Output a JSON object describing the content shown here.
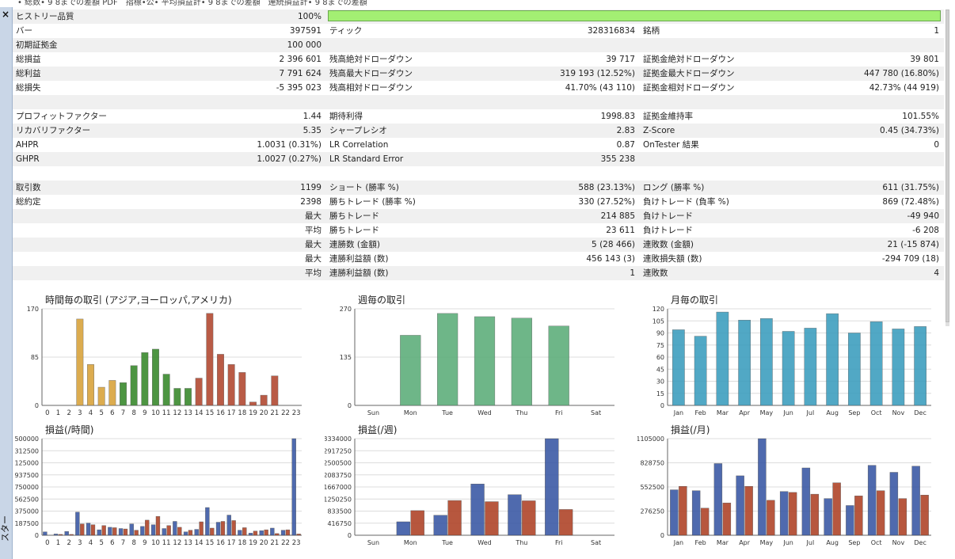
{
  "window": {
    "top_strip_text": "• 総数• 9 8までの差額 PDF　指標•公• 平均損益計• 9 8までの差額　連続損益計• 9 8までの差額",
    "close_glyph": "×",
    "side_label": "スター"
  },
  "report": {
    "quality": {
      "label": "ヒストリー品質",
      "value": "100%",
      "fill_percent": 100
    },
    "rows": [
      {
        "cells": [
          [
            "バー",
            "397591"
          ],
          [
            "ティック",
            "328316834"
          ],
          [
            "銘柄",
            "1"
          ]
        ]
      },
      {
        "cells": [
          [
            "初期証拠金",
            "100 000"
          ],
          [
            "",
            ""
          ],
          [
            "",
            ""
          ]
        ]
      },
      {
        "cells": [
          [
            "総損益",
            "2 396 601"
          ],
          [
            "残高絶対ドローダウン",
            "39 717"
          ],
          [
            "証拠金絶対ドローダウン",
            "39 801"
          ]
        ]
      },
      {
        "cells": [
          [
            "総利益",
            "7 791 624"
          ],
          [
            "残高最大ドローダウン",
            "319 193 (12.52%)"
          ],
          [
            "証拠金最大ドローダウン",
            "447 780 (16.80%)"
          ]
        ]
      },
      {
        "cells": [
          [
            "総損失",
            "-5 395 023"
          ],
          [
            "残高相対ドローダウン",
            "41.70% (43 110)"
          ],
          [
            "証拠金相対ドローダウン",
            "42.73% (44 919)"
          ]
        ]
      },
      {
        "blank": true
      },
      {
        "cells": [
          [
            "プロフィットファクター",
            "1.44"
          ],
          [
            "期待利得",
            "1998.83"
          ],
          [
            "証拠金維持率",
            "101.55%"
          ]
        ]
      },
      {
        "cells": [
          [
            "リカバリファクター",
            "5.35"
          ],
          [
            "シャープレシオ",
            "2.83"
          ],
          [
            "Z-Score",
            "0.45 (34.73%)"
          ]
        ]
      },
      {
        "cells": [
          [
            "AHPR",
            "1.0031 (0.31%)"
          ],
          [
            "LR Correlation",
            "0.87"
          ],
          [
            "OnTester 結果",
            "0"
          ]
        ]
      },
      {
        "cells": [
          [
            "GHPR",
            "1.0027 (0.27%)"
          ],
          [
            "LR Standard Error",
            "355 238"
          ],
          [
            "",
            ""
          ]
        ]
      },
      {
        "blank": true
      },
      {
        "cells": [
          [
            "取引数",
            "1199"
          ],
          [
            "ショート (勝率 %)",
            "588 (23.13%)"
          ],
          [
            "ロング (勝率 %)",
            "611 (31.75%)"
          ]
        ]
      },
      {
        "cells": [
          [
            "総約定",
            "2398"
          ],
          [
            "勝ちトレード (勝率 %)",
            "330 (27.52%)"
          ],
          [
            "負けトレード (負率 %)",
            "869 (72.48%)"
          ]
        ]
      },
      {
        "cells": [
          [
            "",
            "最大"
          ],
          [
            "勝ちトレード",
            "214 885"
          ],
          [
            "負けトレード",
            "-49 940"
          ]
        ]
      },
      {
        "cells": [
          [
            "",
            "平均"
          ],
          [
            "勝ちトレード",
            "23 611"
          ],
          [
            "負けトレード",
            "-6 208"
          ]
        ]
      },
      {
        "cells": [
          [
            "",
            "最大"
          ],
          [
            "連勝数 (金額)",
            "5 (28 466)"
          ],
          [
            "連敗数 (金額)",
            "21 (-15 874)"
          ]
        ]
      },
      {
        "cells": [
          [
            "",
            "最大"
          ],
          [
            "連勝利益額 (数)",
            "456 143 (3)"
          ],
          [
            "連敗損失額 (数)",
            "-294 709 (18)"
          ]
        ]
      },
      {
        "cells": [
          [
            "",
            "平均"
          ],
          [
            "連勝利益額 (数)",
            "1"
          ],
          [
            "連敗数",
            "4"
          ]
        ]
      },
      {
        "blank": true
      }
    ]
  },
  "colors": {
    "quality_bar": "#a3ef73",
    "grid": "#dcdcdc",
    "axis": "#666666",
    "asia": "#d9a43c",
    "europe": "#3a8a2e",
    "america": "#b24a33",
    "week": "#5faf7c",
    "month": "#3f9fbf",
    "profit": "#3c5aa6",
    "loss": "#b0452a"
  },
  "chart_data": [
    {
      "type": "bar",
      "title": "時間毎の取引 (アジア,ヨーロッパ,アメリカ)",
      "categories": [
        "0",
        "1",
        "2",
        "3",
        "4",
        "5",
        "6",
        "7",
        "8",
        "9",
        "10",
        "11",
        "12",
        "13",
        "14",
        "15",
        "16",
        "17",
        "18",
        "19",
        "20",
        "21",
        "22",
        "23"
      ],
      "values": [
        0,
        0,
        0,
        152,
        72,
        32,
        44,
        40,
        70,
        93,
        99,
        55,
        30,
        30,
        48,
        162,
        90,
        72,
        58,
        6,
        18,
        52,
        0,
        0
      ],
      "color_groups": [
        "none",
        "none",
        "none",
        "asia",
        "asia",
        "asia",
        "asia",
        "europe",
        "europe",
        "europe",
        "europe",
        "europe",
        "europe",
        "europe",
        "america",
        "america",
        "america",
        "america",
        "america",
        "america",
        "america",
        "america",
        "none",
        "none"
      ],
      "ylim": [
        0,
        170
      ],
      "yticks": [
        "170",
        "85",
        "0"
      ]
    },
    {
      "type": "bar",
      "title": "週毎の取引",
      "categories": [
        "Sun",
        "Mon",
        "Tue",
        "Wed",
        "Thu",
        "Fri",
        "Sat"
      ],
      "values": [
        0,
        196,
        257,
        248,
        244,
        222,
        0
      ],
      "ylim": [
        0,
        270
      ],
      "yticks": [
        "270",
        "135",
        "0"
      ]
    },
    {
      "type": "bar",
      "title": "月毎の取引",
      "categories": [
        "Jan",
        "Feb",
        "Mar",
        "Apr",
        "May",
        "Jun",
        "Jul",
        "Aug",
        "Sep",
        "Oct",
        "Nov",
        "Dec"
      ],
      "values": [
        94,
        86,
        116,
        106,
        108,
        92,
        96,
        114,
        90,
        104,
        95,
        98
      ],
      "ylim": [
        0,
        120
      ],
      "yticks": [
        "120",
        "105",
        "90",
        "75",
        "60",
        "45",
        "30",
        "15",
        "0"
      ]
    },
    {
      "type": "bar",
      "title": "損益(/時間)",
      "categories": [
        "0",
        "1",
        "2",
        "3",
        "4",
        "5",
        "6",
        "7",
        "8",
        "9",
        "10",
        "11",
        "12",
        "13",
        "14",
        "15",
        "16",
        "17",
        "18",
        "19",
        "20",
        "21",
        "22",
        "23"
      ],
      "series": [
        {
          "values": [
            8,
            3,
            9,
            55,
            29,
            13,
            19,
            16,
            27,
            21,
            25,
            16,
            33,
            8,
            14,
            66,
            31,
            48,
            12,
            5,
            11,
            17,
            12,
            230
          ]
        },
        {
          "values": [
            0,
            2,
            2,
            27,
            25,
            23,
            18,
            15,
            12,
            36,
            45,
            23,
            19,
            12,
            32,
            17,
            33,
            35,
            18,
            10,
            13,
            4,
            13,
            3
          ]
        }
      ],
      "ylim": [
        0,
        500000
      ],
      "yticks": [
        "500000",
        "312500",
        "125000",
        "937500",
        "750000",
        "562500",
        "375000",
        "187500",
        "0"
      ]
    },
    {
      "type": "bar",
      "title": "損益(/週)",
      "categories": [
        "Sun",
        "Mon",
        "Tue",
        "Wed",
        "Thu",
        "Fri",
        "Sat"
      ],
      "series": [
        {
          "values": [
            0,
            465000,
            690000,
            1770000,
            1400000,
            3334000,
            0
          ]
        },
        {
          "values": [
            0,
            850000,
            1200000,
            1160000,
            1190000,
            890000,
            0
          ]
        }
      ],
      "ylim": [
        0,
        3334000
      ],
      "yticks": [
        "3334000",
        "2917250",
        "2500500",
        "2083750",
        "1667000",
        "1250250",
        "833500",
        "416750",
        "0"
      ]
    },
    {
      "type": "bar",
      "title": "損益(/月)",
      "categories": [
        "Jan",
        "Feb",
        "Mar",
        "Apr",
        "May",
        "Jun",
        "Jul",
        "Aug",
        "Sep",
        "Oct",
        "Nov",
        "Dec"
      ],
      "series": [
        {
          "values": [
            520000,
            510000,
            820000,
            680000,
            1105000,
            500000,
            770000,
            420000,
            340000,
            800000,
            720000,
            790000
          ]
        },
        {
          "values": [
            560000,
            310000,
            370000,
            560000,
            400000,
            490000,
            470000,
            600000,
            450000,
            510000,
            420000,
            460000
          ]
        }
      ],
      "ylim": [
        0,
        1105000
      ],
      "yticks": [
        "1105000",
        "828750",
        "552500",
        "276250",
        "0"
      ]
    }
  ]
}
